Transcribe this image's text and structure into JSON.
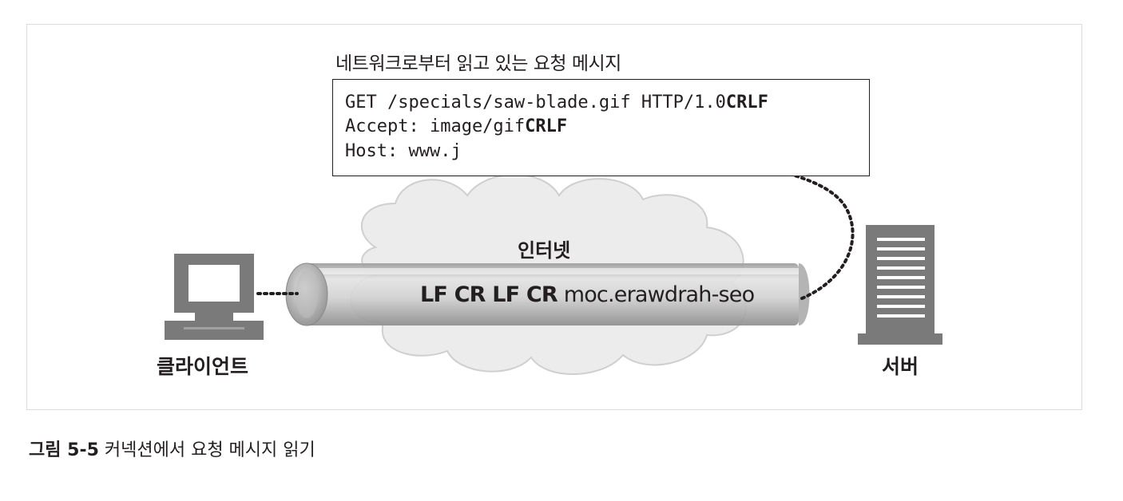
{
  "message_box": {
    "title": "네트워크로부터 읽고 있는 요청 메시지",
    "lines": [
      {
        "text": "GET /specials/saw-blade.gif HTTP/1.0",
        "suffix": "CRLF"
      },
      {
        "text": "Accept: image/gif",
        "suffix": "CRLF"
      },
      {
        "text": "Host: www.j",
        "suffix": ""
      }
    ]
  },
  "network": {
    "label": "인터넷",
    "stream_bold": "LF CR LF CR",
    "stream_rest": " moc.erawdrah-seo"
  },
  "client": {
    "label": "클라이언트",
    "icon": "computer-icon"
  },
  "server": {
    "label": "서버",
    "icon": "server-icon"
  },
  "caption": {
    "label": "그림 5-5",
    "text": " 커넥션에서 요청 메시지 읽기"
  },
  "colors": {
    "ink": "#231f20",
    "cloud": "#ececec",
    "pipe": "#c8c8c8",
    "device": "#7a7a7a"
  }
}
